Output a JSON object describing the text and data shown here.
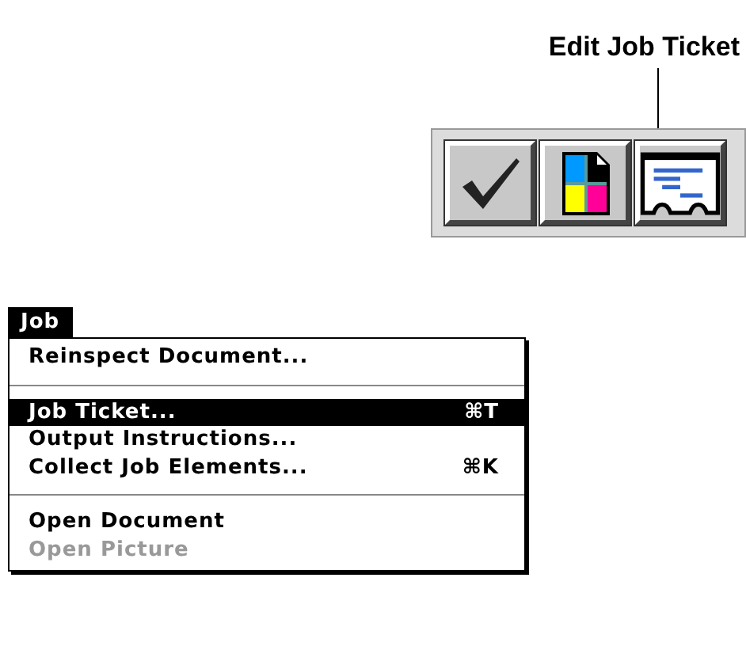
{
  "callout": {
    "label": "Edit Job Ticket"
  },
  "toolbar": {
    "buttons": [
      {
        "kind": "check"
      },
      {
        "kind": "color"
      },
      {
        "kind": "ticket"
      }
    ]
  },
  "menu": {
    "title": "Job",
    "items": [
      {
        "kind": "item",
        "label": "Reinspect Document...",
        "selected": false,
        "disabled": false
      },
      {
        "kind": "separator"
      },
      {
        "kind": "item",
        "label": "Job Ticket...",
        "shortcut": "⌘T",
        "selected": true,
        "disabled": false
      },
      {
        "kind": "item",
        "label": "Output Instructions...",
        "selected": false,
        "disabled": false
      },
      {
        "kind": "item",
        "label": "Collect Job Elements...",
        "shortcut": "⌘K",
        "selected": false,
        "disabled": false
      },
      {
        "kind": "separator"
      },
      {
        "kind": "item",
        "label": "Open Document",
        "selected": false,
        "disabled": false
      },
      {
        "kind": "item",
        "label": "Open Picture",
        "selected": false,
        "disabled": true
      }
    ]
  }
}
